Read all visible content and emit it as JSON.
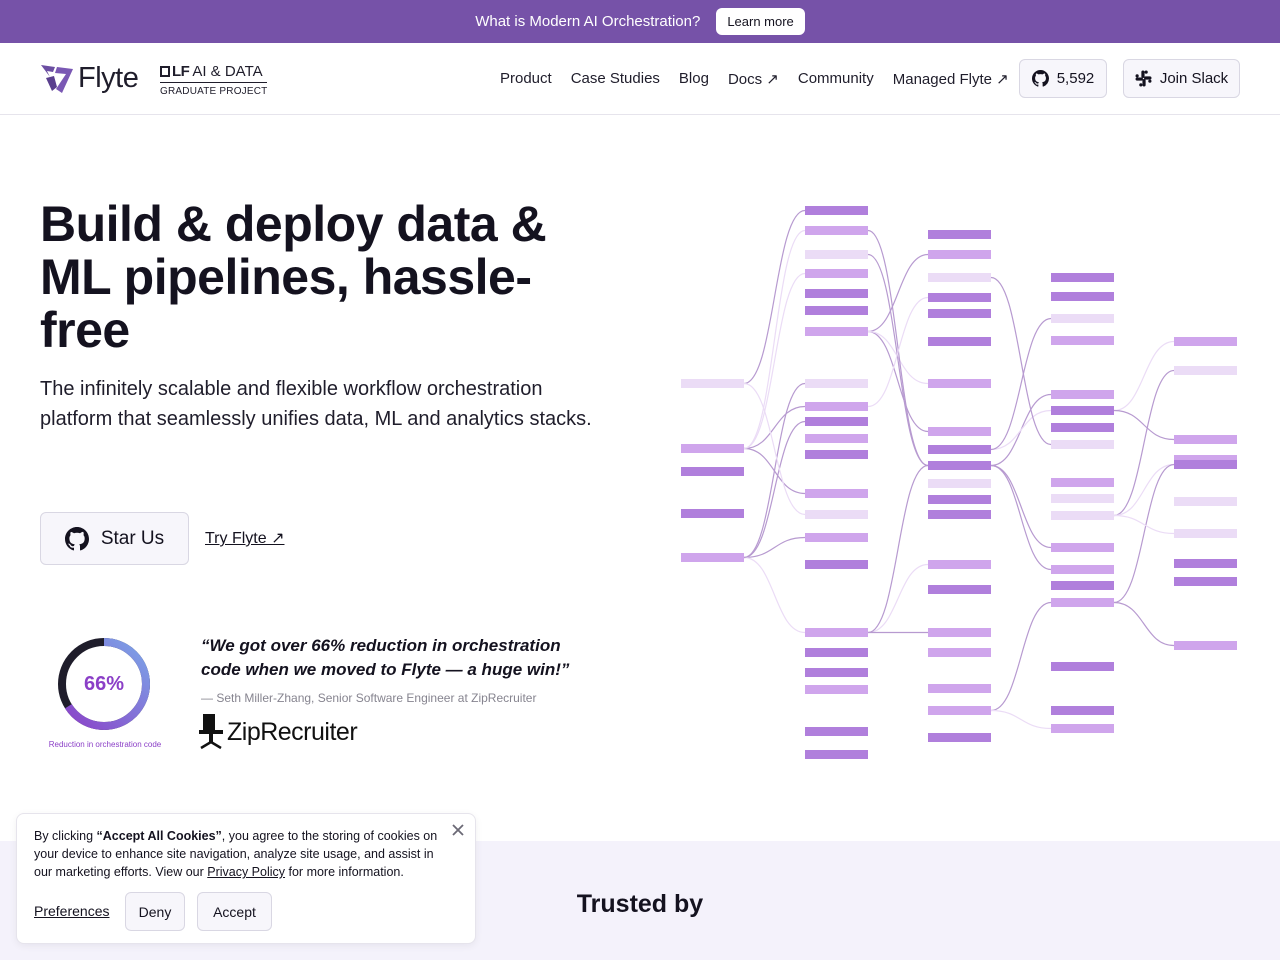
{
  "announcement": {
    "text": "What is Modern AI Orchestration?",
    "button": "Learn more"
  },
  "header": {
    "logo_text": "Flyte",
    "lf_top": "AI & DATA",
    "lf_prefix": "LF",
    "lf_sub": "GRADUATE PROJECT",
    "nav": [
      "Product",
      "Case Studies",
      "Blog",
      "Docs ↗",
      "Community",
      "Managed Flyte ↗"
    ],
    "github_stars": "5,592",
    "slack_label": "Join Slack"
  },
  "hero": {
    "title": "Build & deploy data & ML pipelines, hassle-free",
    "subtitle": "The infinitely scalable and flexible workflow orchestration platform that seamlessly unifies data, ML and analytics stacks.",
    "star_button": "Star Us",
    "try_link": "Try Flyte ↗"
  },
  "testimonial": {
    "stat_value": "66%",
    "stat_fraction": 0.66,
    "stat_label": "Reduction in orchestration code",
    "quote": "“We got over 66% reduction in orchestration code when we moved to Flyte — a huge win!”",
    "attribution": "— Seth Miller-Zhang, Senior Software Engineer at ZipRecruiter",
    "company": "ZipRecruiter"
  },
  "trusted": {
    "title": "Trusted by"
  },
  "cookie": {
    "text_before": "By clicking ",
    "text_bold": "“Accept All Cookies”",
    "text_middle": ", you agree to the storing of cookies on your device to enhance site navigation, analyze site usage, and assist in our marketing efforts. View our ",
    "privacy_link": "Privacy Policy",
    "text_after": " for more information.",
    "preferences": "Preferences",
    "deny": "Deny",
    "accept": "Accept"
  },
  "colors": {
    "announce_bg": "#7652a8",
    "node_strong": "#b07fdc",
    "node_mid": "#cfa5ec",
    "node_light": "#ebdcf6",
    "donut_purple": "#8b3fc7",
    "donut_blue": "#7ba6e8"
  }
}
